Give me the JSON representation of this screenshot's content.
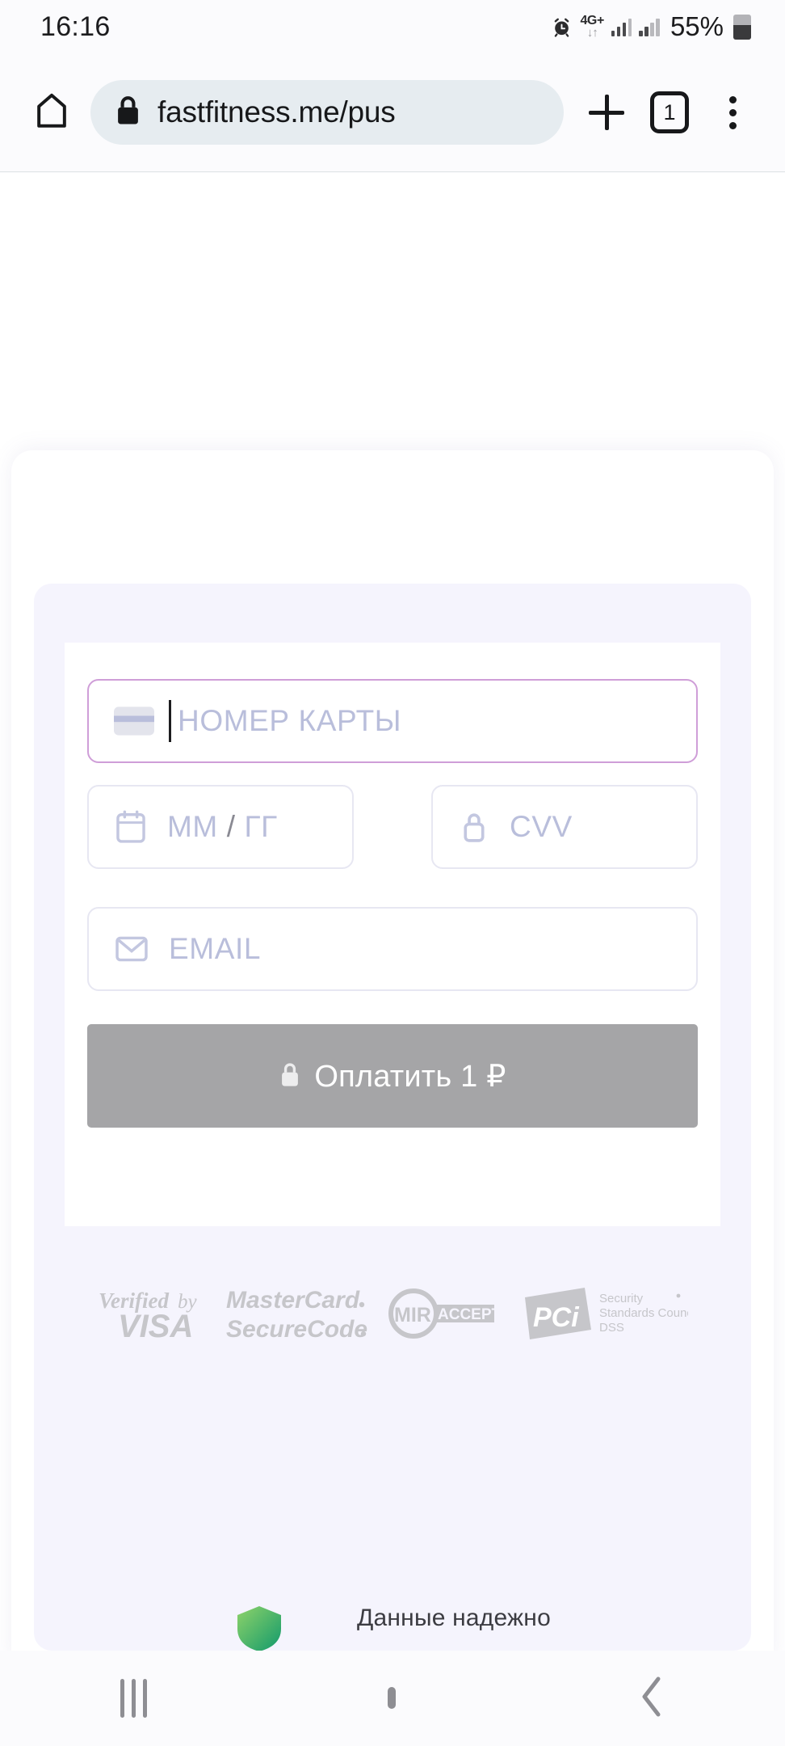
{
  "status_bar": {
    "time": "16:16",
    "alarm_icon": "alarm-clock-icon",
    "network_type": "4G+",
    "data_arrows": "↓↑",
    "signal_icon_1": "signal-bars-icon",
    "signal_icon_2": "signal-bars-icon",
    "battery_percent": "55%",
    "battery_icon": "battery-icon"
  },
  "browser": {
    "home_icon": "home-icon",
    "lock_icon": "lock-icon",
    "url": "fastfitness.me/pu",
    "url_truncated_char": "s",
    "new_tab_icon": "plus-icon",
    "tab_count": "1",
    "menu_icon": "kebab-menu-icon"
  },
  "payment_form": {
    "card_number": {
      "icon": "credit-card-icon",
      "placeholder": "НОМЕР КАРТЫ",
      "value": "",
      "focused": true
    },
    "expiry": {
      "icon": "calendar-icon",
      "placeholder_month": "ММ",
      "placeholder_separator": "/",
      "placeholder_year": "ГГ",
      "value": ""
    },
    "cvv": {
      "icon": "lock-icon",
      "placeholder": "CVV",
      "value": ""
    },
    "email": {
      "icon": "envelope-icon",
      "placeholder": "EMAIL",
      "value": ""
    },
    "pay_button": {
      "icon": "lock-icon",
      "label": "Оплатить 1 ₽",
      "disabled": true,
      "background_color": "#a5a5a7",
      "text_color": "#ffffff"
    },
    "focus_border_color": "#cf9ed8",
    "placeholder_color": "#b9bedb",
    "panel_color": "#f5f4fd"
  },
  "security_badges": [
    {
      "name": "verified-by-visa-badge",
      "line1": "Verified by",
      "line2": "VISA"
    },
    {
      "name": "mastercard-securecode-badge",
      "line1": "MasterCard",
      "line2": "SecureCode"
    },
    {
      "name": "mir-accept-badge",
      "line1": "MIR",
      "line2": "ACCEPT"
    },
    {
      "name": "pci-dss-badge",
      "line1": "PCI",
      "line2": "Security Standards Council DSS"
    }
  ],
  "footer": {
    "shield_icon": "green-shield-icon",
    "text": "Данные надежно"
  },
  "nav_bar": {
    "recents_icon": "recents-icon",
    "home_icon": "home-square-icon",
    "back_icon": "back-chevron-icon"
  }
}
